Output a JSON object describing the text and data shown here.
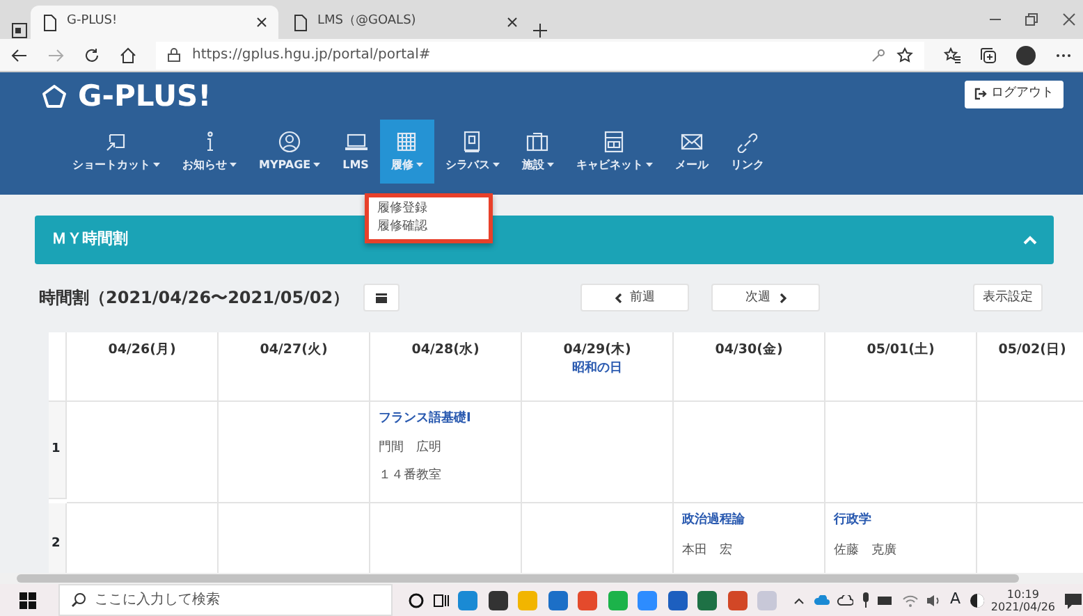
{
  "browser": {
    "tabs": [
      {
        "title": "G-PLUS!",
        "selected": true
      },
      {
        "title": "LMS（@GOALS)",
        "selected": false
      }
    ],
    "address": "https://gplus.hgu.jp/portal/portal#"
  },
  "header": {
    "logo": "G-PLUS!",
    "logout": "ログアウト",
    "nav": [
      {
        "label": "ショートカット",
        "dropdown": true,
        "selected": false
      },
      {
        "label": "お知らせ",
        "dropdown": true,
        "selected": false
      },
      {
        "label": "MYPAGE",
        "dropdown": true,
        "selected": false
      },
      {
        "label": "LMS",
        "dropdown": false,
        "selected": false
      },
      {
        "label": "履修",
        "dropdown": true,
        "selected": true
      },
      {
        "label": "シラバス",
        "dropdown": true,
        "selected": false
      },
      {
        "label": "施設",
        "dropdown": true,
        "selected": false
      },
      {
        "label": "キャビネット",
        "dropdown": true,
        "selected": false
      },
      {
        "label": "メール",
        "dropdown": false,
        "selected": false
      },
      {
        "label": "リンク",
        "dropdown": false,
        "selected": false
      }
    ],
    "menu": [
      "履修登録",
      "履修確認"
    ]
  },
  "panel": {
    "title": "ＭＹ時間割",
    "expanded": true
  },
  "timetable": {
    "title": "時間割（2021/04/26〜2021/05/02）",
    "prev": "前週",
    "next": "次週",
    "settings": "表示設定",
    "days": [
      {
        "date": "04/26(月)"
      },
      {
        "date": "04/27(火)"
      },
      {
        "date": "04/28(水)"
      },
      {
        "date": "04/29(木)",
        "holiday": "昭和の日"
      },
      {
        "date": "04/30(金)"
      },
      {
        "date": "05/01(土)"
      },
      {
        "date": "05/02(日)"
      }
    ],
    "rows": [
      {
        "period": "1",
        "cells": [
          null,
          null,
          {
            "course": "フランス語基礎Ⅰ",
            "teacher": "門間　広明",
            "room": "１４番教室"
          },
          null,
          null,
          null,
          null
        ]
      },
      {
        "period": "2",
        "cells": [
          null,
          null,
          null,
          null,
          {
            "course": "政治過程論",
            "teacher": "本田　宏"
          },
          {
            "course": "行政学",
            "teacher": "佐藤　克廣"
          },
          null
        ]
      }
    ]
  },
  "taskbar": {
    "search_placeholder": "ここに入力して検索",
    "ime": "A",
    "time": "10:19",
    "date": "2021/04/26"
  }
}
